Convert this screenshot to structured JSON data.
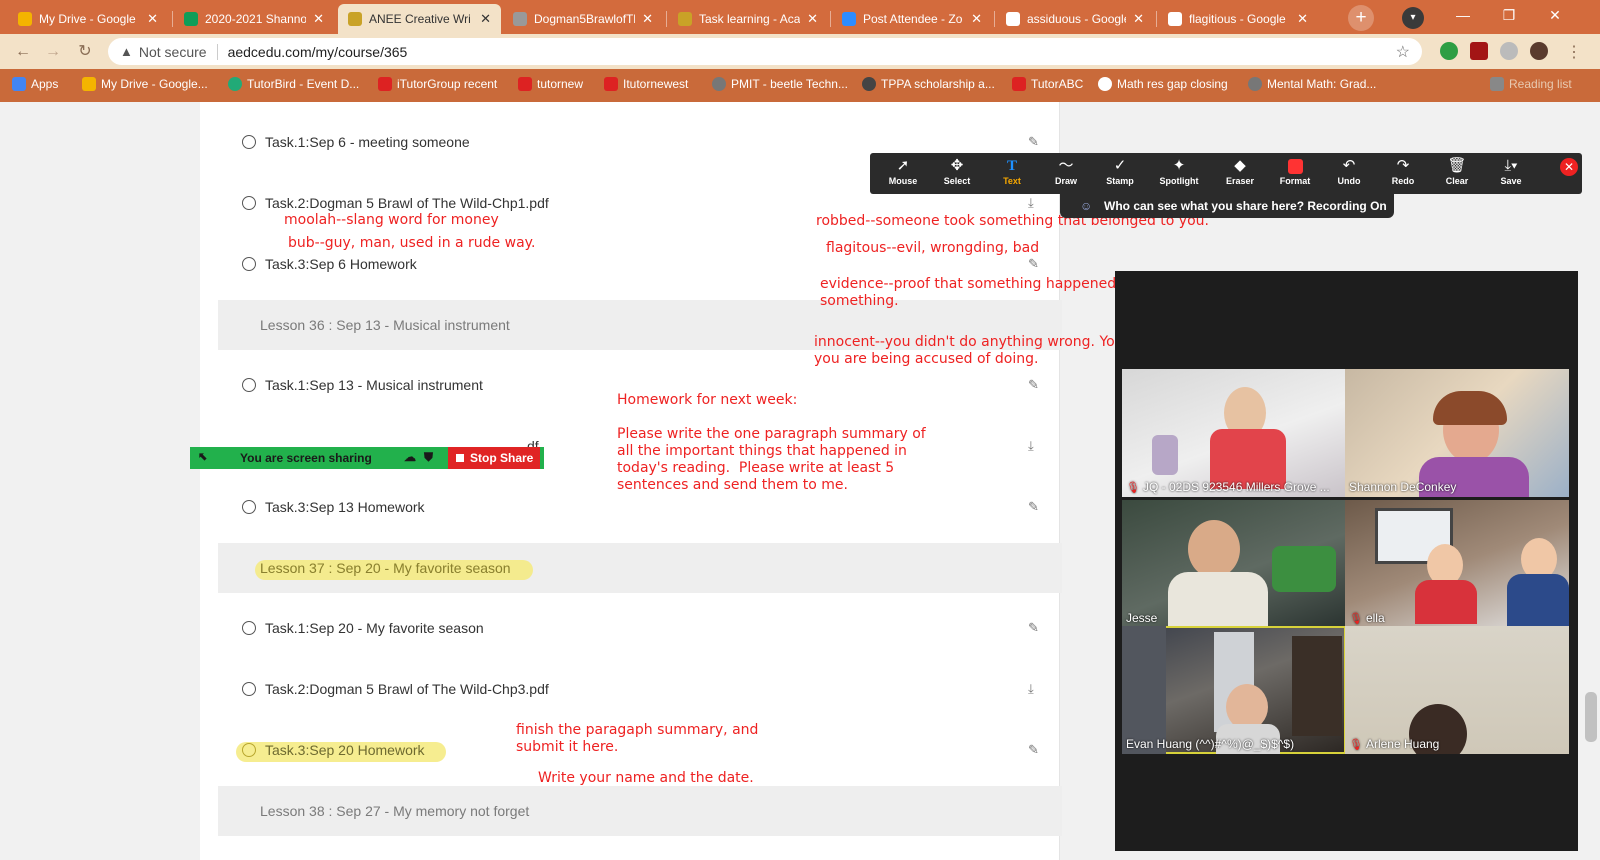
{
  "browser": {
    "tabs": [
      {
        "title": "My Drive - Google",
        "fav_color": "#f4b400",
        "active": false
      },
      {
        "title": "2020-2021 Shanno",
        "fav_color": "#0f9d58",
        "active": false
      },
      {
        "title": "ANEE Creative Wri",
        "fav_color": "#c9a227",
        "active": true
      },
      {
        "title": "Dogman5BrawlofTh",
        "fav_color": "#999999",
        "active": false
      },
      {
        "title": "Task learning - Aca",
        "fav_color": "#c9a227",
        "active": false
      },
      {
        "title": "Post Attendee - Zo",
        "fav_color": "#2d8cff",
        "active": false
      },
      {
        "title": "assiduous - Google",
        "fav_color": "#ffffff",
        "active": false
      },
      {
        "title": "flagitious - Google",
        "fav_color": "#ffffff",
        "active": false
      }
    ],
    "new_tab_label": "+",
    "not_secure": "Not secure",
    "url": "aedcedu.com/my/course/365",
    "bookmarks": [
      {
        "label": "Apps",
        "color": "#4285f4"
      },
      {
        "label": "My Drive - Google...",
        "color": "#f4b400"
      },
      {
        "label": "TutorBird - Event D...",
        "color": "#2a7"
      },
      {
        "label": "iTutorGroup recent",
        "color": "#d22"
      },
      {
        "label": "tutornew",
        "color": "#d22"
      },
      {
        "label": "Itutornewest",
        "color": "#d22"
      },
      {
        "label": "PMIT - beetle Techn...",
        "color": "#777"
      },
      {
        "label": "TPPA scholarship a...",
        "color": "#444"
      },
      {
        "label": "TutorABC",
        "color": "#d22"
      },
      {
        "label": "Math res gap closing",
        "color": "#fff"
      },
      {
        "label": "Mental Math: Grad...",
        "color": "#777"
      },
      {
        "label": "Reading list",
        "color": "#888"
      }
    ]
  },
  "course": {
    "tasks": [
      {
        "label": "Task.1:Sep 6 - meeting someone",
        "icon": "pencil-icon",
        "highlight": false
      },
      {
        "label": "Task.2:Dogman 5 Brawl of The Wild-Chp1.pdf",
        "icon": "download-icon",
        "highlight": false
      },
      {
        "label": "Task.3:Sep 6 Homework",
        "icon": "pencil-icon",
        "highlight": false
      },
      {
        "label": "Task.1:Sep 13 - Musical instrument",
        "icon": "pencil-icon",
        "highlight": false
      },
      {
        "label": "df",
        "icon": "download-icon",
        "highlight": false
      },
      {
        "label": "Task.3:Sep 13 Homework",
        "icon": "pencil-icon",
        "highlight": false
      },
      {
        "label": "Task.1:Sep 20 - My favorite season",
        "icon": "pencil-icon",
        "highlight": false
      },
      {
        "label": "Task.2:Dogman 5 Brawl of The Wild-Chp3.pdf",
        "icon": "download-icon",
        "highlight": false
      },
      {
        "label": "Task.3:Sep 20 Homework",
        "icon": "pencil-icon",
        "highlight": true
      }
    ],
    "lessons": [
      {
        "label": "Lesson 36 : Sep 13 - Musical instrument",
        "highlight": false
      },
      {
        "label": "Lesson 37 : Sep 20 - My favorite season",
        "highlight": true
      },
      {
        "label": "Lesson 38 : Sep 27 - My memory not forget",
        "highlight": false
      }
    ]
  },
  "annotations": [
    "moolah--slang word for money",
    "bub--guy, man, used in a rude way.",
    "robbed--someone took something that belonged to you.",
    "flagitous--evil, wrongding, bad",
    "evidence--proof that something happened\nsomething.",
    "innocent--you didn't do anything wrong. Yo\nyou are being accused of doing.",
    "Homework for next week:\n\nPlease write the one paragraph summary of\nall the important things that happened in\ntoday's reading.  Please write at least 5\nsentences and send them to me.",
    "finish the paragaph summary, and\nsubmit it here.",
    "Write your name and the date."
  ],
  "zoom_toolbar": {
    "buttons": [
      {
        "label": "Mouse",
        "icon": "cursor-icon",
        "active": false
      },
      {
        "label": "Select",
        "icon": "move-icon",
        "active": false
      },
      {
        "label": "Text",
        "icon": "text-icon",
        "active": true
      },
      {
        "label": "Draw",
        "icon": "draw-icon",
        "active": false
      },
      {
        "label": "Stamp",
        "icon": "check-icon",
        "active": false
      },
      {
        "label": "Spotlight",
        "icon": "spotlight-icon",
        "active": false
      },
      {
        "label": "Eraser",
        "icon": "eraser-icon",
        "active": false
      },
      {
        "label": "Format",
        "icon": "format-icon",
        "active": false
      },
      {
        "label": "Undo",
        "icon": "undo-icon",
        "active": false
      },
      {
        "label": "Redo",
        "icon": "redo-icon",
        "active": false
      },
      {
        "label": "Clear",
        "icon": "trash-icon",
        "active": false
      },
      {
        "label": "Save",
        "icon": "save-icon",
        "active": false
      }
    ],
    "banner": "Who can see what you share here? Recording On",
    "format_color": "#ff3333"
  },
  "share_bar": {
    "status": "You are screen sharing",
    "stop_label": "Stop Share"
  },
  "gallery": {
    "participants": [
      {
        "name": "JQ - 02DS 923546 Millers Grove ...",
        "muted": true,
        "speaking": false
      },
      {
        "name": "Shannon DeConkey",
        "muted": false,
        "speaking": false
      },
      {
        "name": "Jesse",
        "muted": false,
        "speaking": false
      },
      {
        "name": "ella",
        "muted": true,
        "speaking": false
      },
      {
        "name": "Evan Huang (^^)#^%)@_$)$^$)",
        "muted": false,
        "speaking": true
      },
      {
        "name": "Arlene Huang",
        "muted": true,
        "speaking": false
      }
    ]
  }
}
